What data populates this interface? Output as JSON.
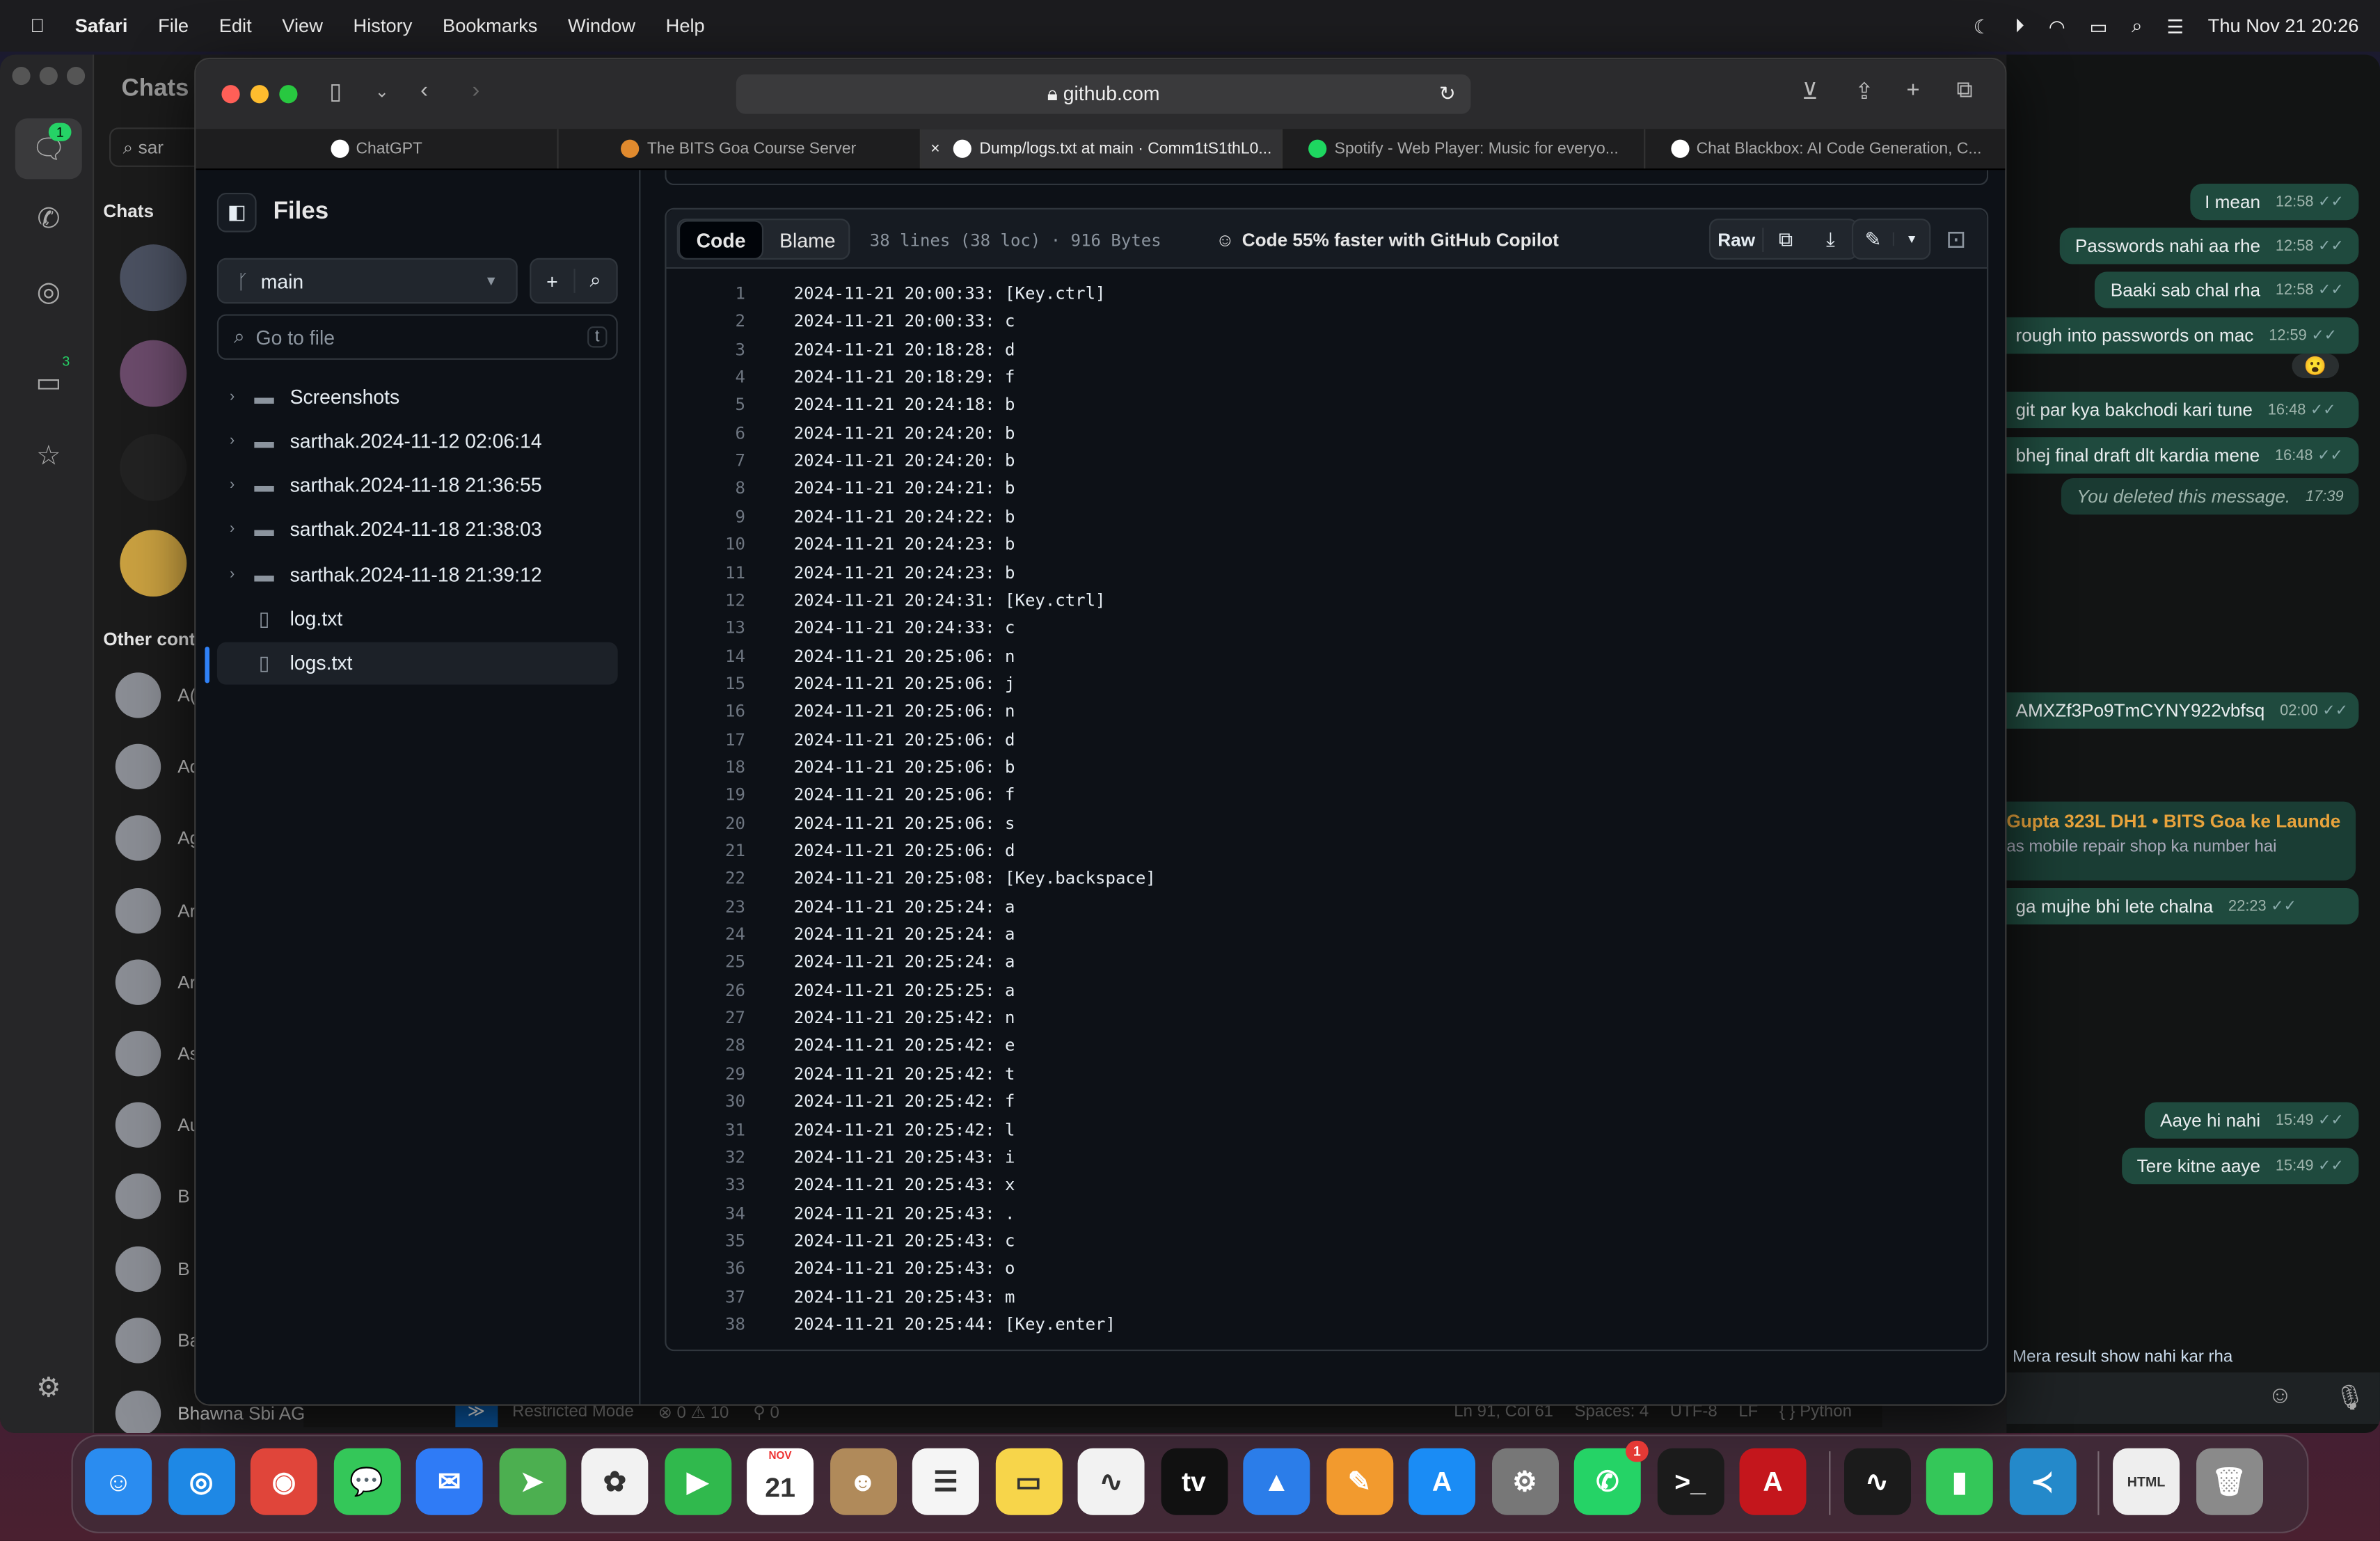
{
  "menubar": {
    "app": "Safari",
    "items": [
      "File",
      "Edit",
      "View",
      "History",
      "Bookmarks",
      "Window",
      "Help"
    ],
    "datetime": "Thu Nov 21  20:26"
  },
  "whatsapp": {
    "title": "Chats",
    "search": "sar",
    "section_chats": "Chats",
    "section_other": "Other cont",
    "rail_badges": {
      "chats": "1",
      "archived": "3"
    },
    "contact_initials": [
      "A(",
      "Ad",
      "Ag",
      "Ar",
      "Ar",
      "As",
      "Au",
      "B",
      "B",
      "Ba"
    ],
    "bottom_contact": "Bhawna Sbi AGM Sarb Corporate",
    "messages": [
      {
        "text": "I mean",
        "time": "12:58"
      },
      {
        "text": "Passwords nahi aa rhe",
        "time": "12:58"
      },
      {
        "text": "Baaki sab chal rha",
        "time": "12:58"
      },
      {
        "text": "rough into passwords on mac",
        "time": "12:59"
      },
      {
        "text": "git par kya bakchodi kari tune",
        "time": "16:48"
      },
      {
        "text": "bhej final draft dlt kardia mene",
        "time": "16:48"
      },
      {
        "text": "You deleted this message.",
        "time": "17:39"
      },
      {
        "text": "AMXZf3Po9TmCYNY922vbfsq",
        "time": "02:00"
      },
      {
        "text": "ga mujhe bhi lete chalna",
        "time": "22:23"
      },
      {
        "text": "Aaye hi nahi",
        "time": "15:49"
      },
      {
        "text": "Tere kitne aaye",
        "time": "15:49"
      }
    ],
    "quote": {
      "author": "Gupta 323L DH1 • BITS Goa ke Launde",
      "text": "as mobile repair shop ka number hai"
    },
    "reaction": "😮",
    "partial_bottom": "Mera result show nahi kar rha"
  },
  "safari": {
    "url": "github.com",
    "tabs": [
      {
        "label": "ChatGPT",
        "color": "#ffffff"
      },
      {
        "label": "The BITS Goa Course Server",
        "color": "#e08a2e"
      },
      {
        "label": "Dump/logs.txt at main · Comm1tS1thL0...",
        "color": "#ffffff",
        "active": true
      },
      {
        "label": "Spotify - Web Player: Music for everyo...",
        "color": "#1ed760"
      },
      {
        "label": "Chat Blackbox: AI Code Generation, C...",
        "color": "#ffffff"
      }
    ]
  },
  "github": {
    "files_title": "Files",
    "branch": "main",
    "goto_placeholder": "Go to file",
    "goto_shortcut": "t",
    "tree": [
      {
        "name": "Screenshots",
        "type": "folder"
      },
      {
        "name": "sarthak.2024-11-12 02:06:14",
        "type": "folder"
      },
      {
        "name": "sarthak.2024-11-18 21:36:55",
        "type": "folder"
      },
      {
        "name": "sarthak.2024-11-18 21:38:03",
        "type": "folder"
      },
      {
        "name": "sarthak.2024-11-18 21:39:12",
        "type": "folder"
      },
      {
        "name": "log.txt",
        "type": "file"
      },
      {
        "name": "logs.txt",
        "type": "file",
        "selected": true
      }
    ],
    "tab_code": "Code",
    "tab_blame": "Blame",
    "file_info": "38 lines (38 loc) · 916 Bytes",
    "copilot": "Code 55% faster with GitHub Copilot",
    "raw": "Raw",
    "lines": [
      "2024-11-21 20:00:33: [Key.ctrl]",
      "2024-11-21 20:00:33: c",
      "2024-11-21 20:18:28: d",
      "2024-11-21 20:18:29: f",
      "2024-11-21 20:24:18: b",
      "2024-11-21 20:24:20: b",
      "2024-11-21 20:24:20: b",
      "2024-11-21 20:24:21: b",
      "2024-11-21 20:24:22: b",
      "2024-11-21 20:24:23: b",
      "2024-11-21 20:24:23: b",
      "2024-11-21 20:24:31: [Key.ctrl]",
      "2024-11-21 20:24:33: c",
      "2024-11-21 20:25:06: n",
      "2024-11-21 20:25:06: j",
      "2024-11-21 20:25:06: n",
      "2024-11-21 20:25:06: d",
      "2024-11-21 20:25:06: b",
      "2024-11-21 20:25:06: f",
      "2024-11-21 20:25:06: s",
      "2024-11-21 20:25:06: d",
      "2024-11-21 20:25:08: [Key.backspace]",
      "2024-11-21 20:25:24: a",
      "2024-11-21 20:25:24: a",
      "2024-11-21 20:25:24: a",
      "2024-11-21 20:25:25: a",
      "2024-11-21 20:25:42: n",
      "2024-11-21 20:25:42: e",
      "2024-11-21 20:25:42: t",
      "2024-11-21 20:25:42: f",
      "2024-11-21 20:25:42: l",
      "2024-11-21 20:25:43: i",
      "2024-11-21 20:25:43: x",
      "2024-11-21 20:25:43: .",
      "2024-11-21 20:25:43: c",
      "2024-11-21 20:25:43: o",
      "2024-11-21 20:25:43: m",
      "2024-11-21 20:25:44: [Key.enter]"
    ]
  },
  "vscode_status": {
    "mode": "Restricted Mode",
    "problems": "⊗ 0 ⚠ 10",
    "ports": "⚲ 0",
    "position": "Ln 91, Col 61",
    "spaces": "Spaces: 4",
    "encoding": "UTF-8",
    "eol": "LF",
    "language": "{ } Python"
  },
  "dock": [
    {
      "name": "finder",
      "glyph": "☺",
      "color": "#2a8cf0"
    },
    {
      "name": "safari",
      "glyph": "◎",
      "color": "#1e88e5"
    },
    {
      "name": "chrome",
      "glyph": "◉",
      "color": "#e0453a"
    },
    {
      "name": "messages",
      "glyph": "💬",
      "color": "#34c759"
    },
    {
      "name": "mail",
      "glyph": "✉",
      "color": "#2f7bf6"
    },
    {
      "name": "maps",
      "glyph": "➤",
      "color": "#4caf50"
    },
    {
      "name": "photos",
      "glyph": "✿",
      "color": "#f2f2f2"
    },
    {
      "name": "facetime",
      "glyph": "▶",
      "color": "#30b94d"
    },
    {
      "name": "calendar",
      "glyph": "21",
      "color": "#ffffff",
      "label": "NOV"
    },
    {
      "name": "contacts",
      "glyph": "☻",
      "color": "#b08a5a"
    },
    {
      "name": "reminders",
      "glyph": "☰",
      "color": "#f5f5f5"
    },
    {
      "name": "notes",
      "glyph": "▭",
      "color": "#f7d54a"
    },
    {
      "name": "freeform",
      "glyph": "∿",
      "color": "#f2f2f2"
    },
    {
      "name": "tv",
      "glyph": "tv",
      "color": "#111111"
    },
    {
      "name": "keynote",
      "glyph": "▲",
      "color": "#2b7de9"
    },
    {
      "name": "pages",
      "glyph": "✎",
      "color": "#f29a2e"
    },
    {
      "name": "app-store",
      "glyph": "A",
      "color": "#1a8cf5"
    },
    {
      "name": "system-settings",
      "glyph": "⚙",
      "color": "#777777"
    },
    {
      "name": "whatsapp",
      "glyph": "✆",
      "color": "#25d366",
      "badge": "1"
    },
    {
      "name": "terminal",
      "glyph": ">_",
      "color": "#1b1b1b"
    },
    {
      "name": "acrobat",
      "glyph": "A",
      "color": "#c4161c"
    },
    {
      "name": "activity-monitor",
      "glyph": "∿",
      "color": "#1b1b1b"
    },
    {
      "name": "numbers",
      "glyph": "▮",
      "color": "#34c759"
    },
    {
      "name": "vscode",
      "glyph": "≺",
      "color": "#2489ca"
    },
    {
      "name": "html-file",
      "glyph": "HTML",
      "color": "#eeeeee"
    },
    {
      "name": "trash",
      "glyph": "🗑",
      "color": "#8a8a8a"
    }
  ]
}
